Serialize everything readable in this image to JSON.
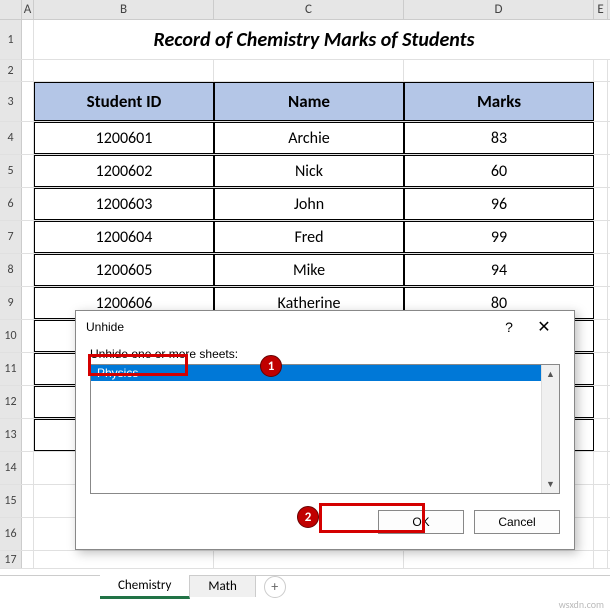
{
  "columns": {
    "a": "A",
    "b": "B",
    "c": "C",
    "d": "D",
    "e": "E"
  },
  "rowLabels": {
    "r1": "1",
    "r2": "2",
    "r3": "3",
    "r4": "4",
    "r5": "5",
    "r6": "6",
    "r7": "7",
    "r8": "8",
    "r9": "9",
    "r10": "10",
    "r11": "11",
    "r12": "12",
    "r13": "13",
    "r14": "14",
    "r15": "15",
    "r16": "16",
    "r17": "17"
  },
  "title": "Record of Chemistry Marks of Students",
  "headers": {
    "id": "Student ID",
    "name": "Name",
    "marks": "Marks"
  },
  "data": [
    {
      "id": "1200601",
      "name": "Archie",
      "marks": "83"
    },
    {
      "id": "1200602",
      "name": "Nick",
      "marks": "60"
    },
    {
      "id": "1200603",
      "name": "John",
      "marks": "96"
    },
    {
      "id": "1200604",
      "name": "Fred",
      "marks": "99"
    },
    {
      "id": "1200605",
      "name": "Mike",
      "marks": "94"
    },
    {
      "id": "1200606",
      "name": "Katherine",
      "marks": "80"
    }
  ],
  "tabs": {
    "t1": "Chemistry",
    "t2": "Math",
    "add": "+"
  },
  "dialog": {
    "title": "Unhide",
    "help": "?",
    "close": "✕",
    "label": "Unhide one or more sheets:",
    "item": "Physics",
    "scrollUp": "▲",
    "scrollDown": "▼",
    "ok": "OK",
    "cancel": "Cancel"
  },
  "badges": {
    "b1": "1",
    "b2": "2"
  },
  "watermark": "wsxdn.com"
}
